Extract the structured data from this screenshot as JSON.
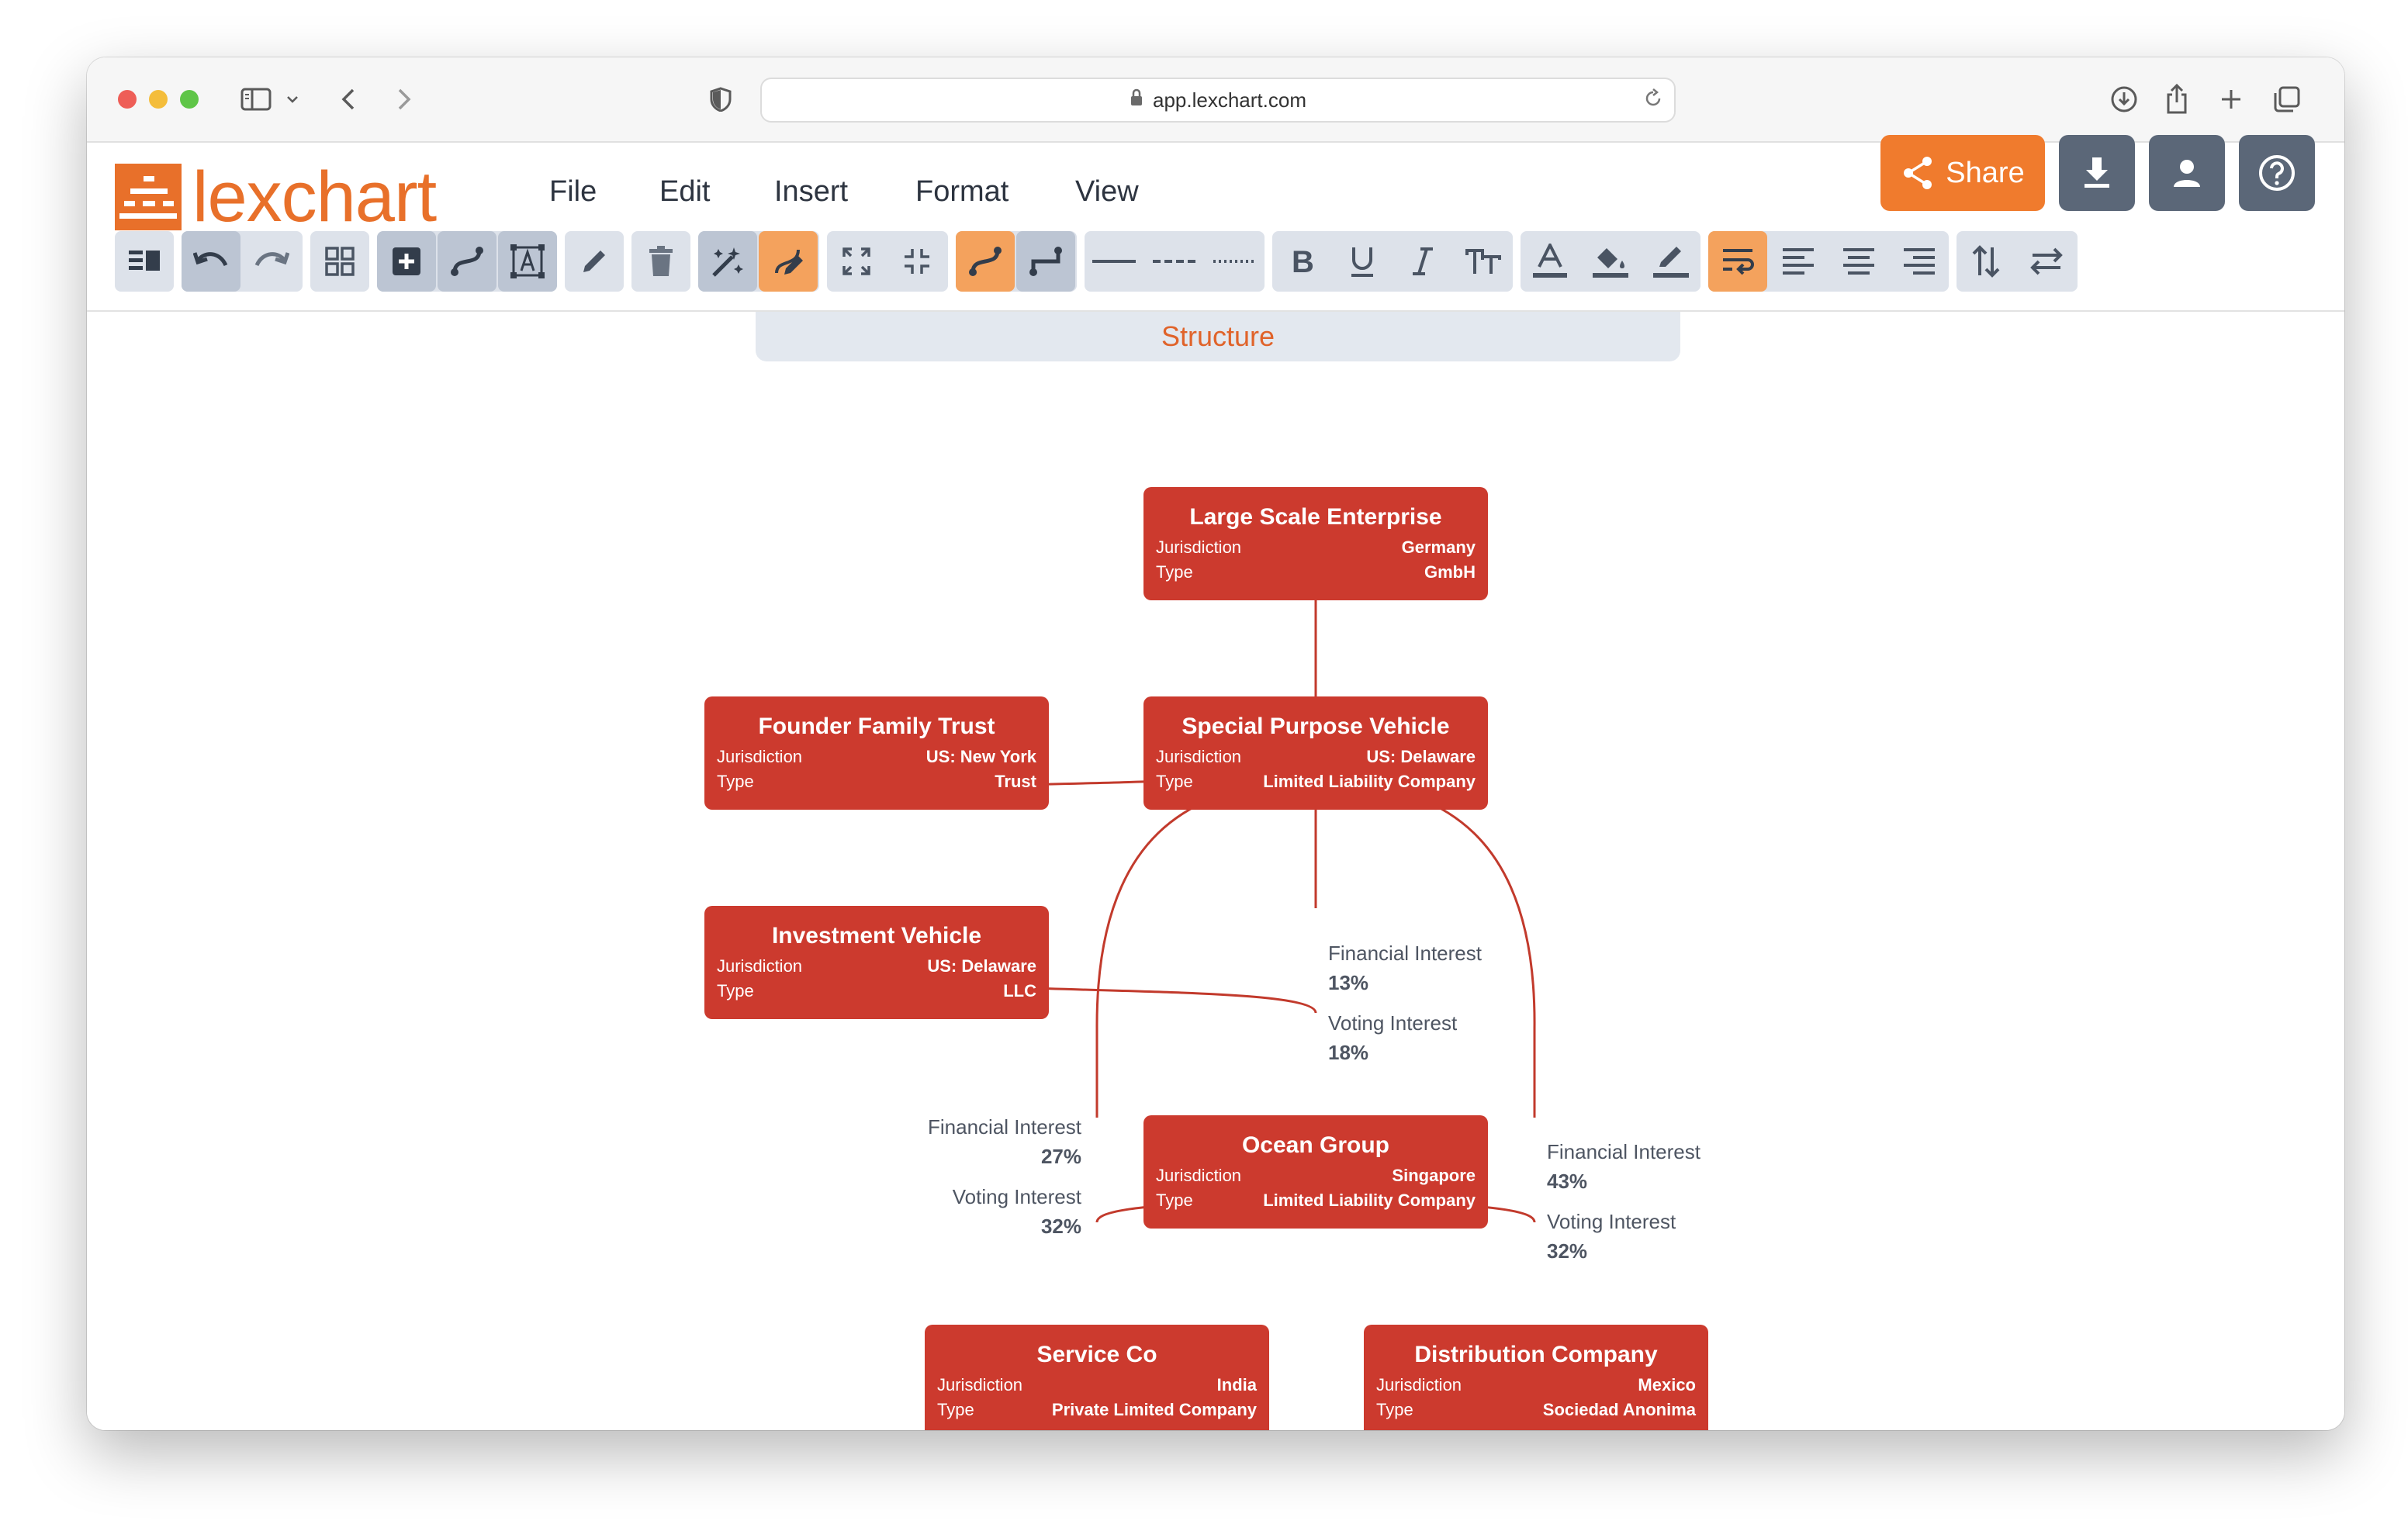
{
  "browser": {
    "url": "app.lexchart.com"
  },
  "app": {
    "logo_text": "lexchart",
    "menu": [
      "File",
      "Edit",
      "Insert",
      "Format",
      "View"
    ],
    "share_label": "Share"
  },
  "toolbar_icons": [
    "panel-icon",
    "undo-icon",
    "redo-icon",
    "grid-icon",
    "add-icon",
    "connector-icon",
    "text-frame-icon",
    "pencil-icon",
    "trash-icon",
    "magic-wand-icon",
    "auto-format-icon",
    "expand-icon",
    "collapse-icon",
    "curved-line-icon",
    "elbow-line-icon",
    "solid-line-icon",
    "dashed-line-icon",
    "dotted-line-icon",
    "bold-icon",
    "underline-icon",
    "italic-icon",
    "text-size-icon",
    "font-color-icon",
    "fill-color-icon",
    "line-color-icon",
    "wrap-text-icon",
    "align-left-icon",
    "align-center-icon",
    "align-right-icon",
    "vertical-swap-icon",
    "horizontal-swap-icon"
  ],
  "canvas": {
    "tab_label": "Structure",
    "labels": {
      "jurisdiction": "Jurisdiction",
      "type": "Type"
    },
    "entities": [
      {
        "id": "lse",
        "name": "Large Scale Enterprise",
        "jurisdiction": "Germany",
        "type": "GmbH"
      },
      {
        "id": "fft",
        "name": "Founder Family Trust",
        "jurisdiction": "US: New York",
        "type": "Trust"
      },
      {
        "id": "spv",
        "name": "Special Purpose Vehicle",
        "jurisdiction": "US: Delaware",
        "type": "Limited Liability Company"
      },
      {
        "id": "iv",
        "name": "Investment Vehicle",
        "jurisdiction": "US: Delaware",
        "type": "LLC"
      },
      {
        "id": "og",
        "name": "Ocean Group",
        "jurisdiction": "Singapore",
        "type": "Limited Liability Company"
      },
      {
        "id": "sc",
        "name": "Service Co",
        "jurisdiction": "India",
        "type": "Private Limited Company"
      },
      {
        "id": "dc",
        "name": "Distribution Company",
        "jurisdiction": "Mexico",
        "type": "Sociedad Anonima"
      }
    ],
    "interest_labels": [
      {
        "id": "og",
        "fin_label": "Financial Interest",
        "fin": "13%",
        "vote_label": "Voting Interest",
        "vote": "18%"
      },
      {
        "id": "sc",
        "fin_label": "Financial Interest",
        "fin": "27%",
        "vote_label": "Voting Interest",
        "vote": "32%"
      },
      {
        "id": "dc",
        "fin_label": "Financial Interest",
        "fin": "43%",
        "vote_label": "Voting Interest",
        "vote": "32%"
      }
    ]
  },
  "colors": {
    "accent": "#f07b2d",
    "node": "#cc3a2e",
    "link": "#c23a2c",
    "button_gray": "#5b6778"
  }
}
